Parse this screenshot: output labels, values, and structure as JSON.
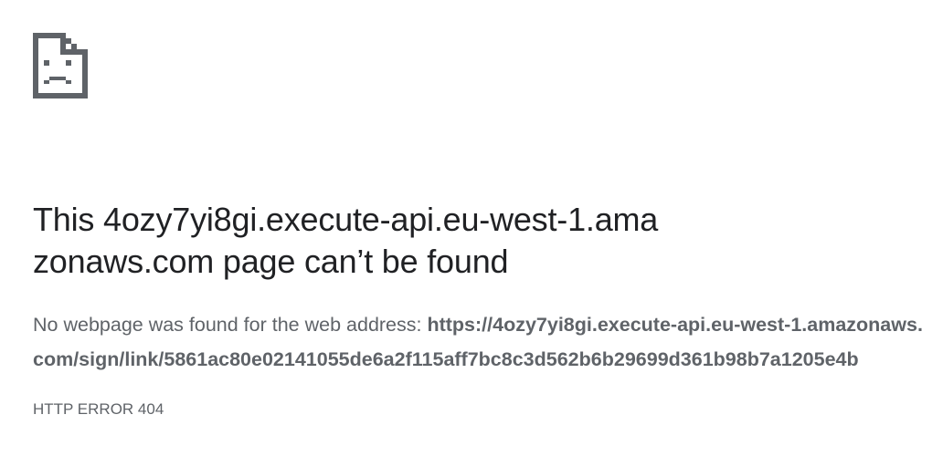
{
  "error_page": {
    "icon": "sad-page-icon",
    "title": "This 4ozy7yi8gi.execute-api.eu-west-1.amazonaws.com page can’t be found",
    "description_prefix": "No webpage was found for the web address: ",
    "url": "https://4ozy7yi8gi.execute-api.eu-west-1.amazonaws.com/sign/link/5861ac80e02141055de6a2f115aff7bc8c3d562b6b29699d361b98b7a1205e4b",
    "error_code": "HTTP ERROR 404"
  },
  "colors": {
    "title": "#202124",
    "body_text": "#5f6368",
    "icon": "#5f6368",
    "background": "#ffffff"
  }
}
